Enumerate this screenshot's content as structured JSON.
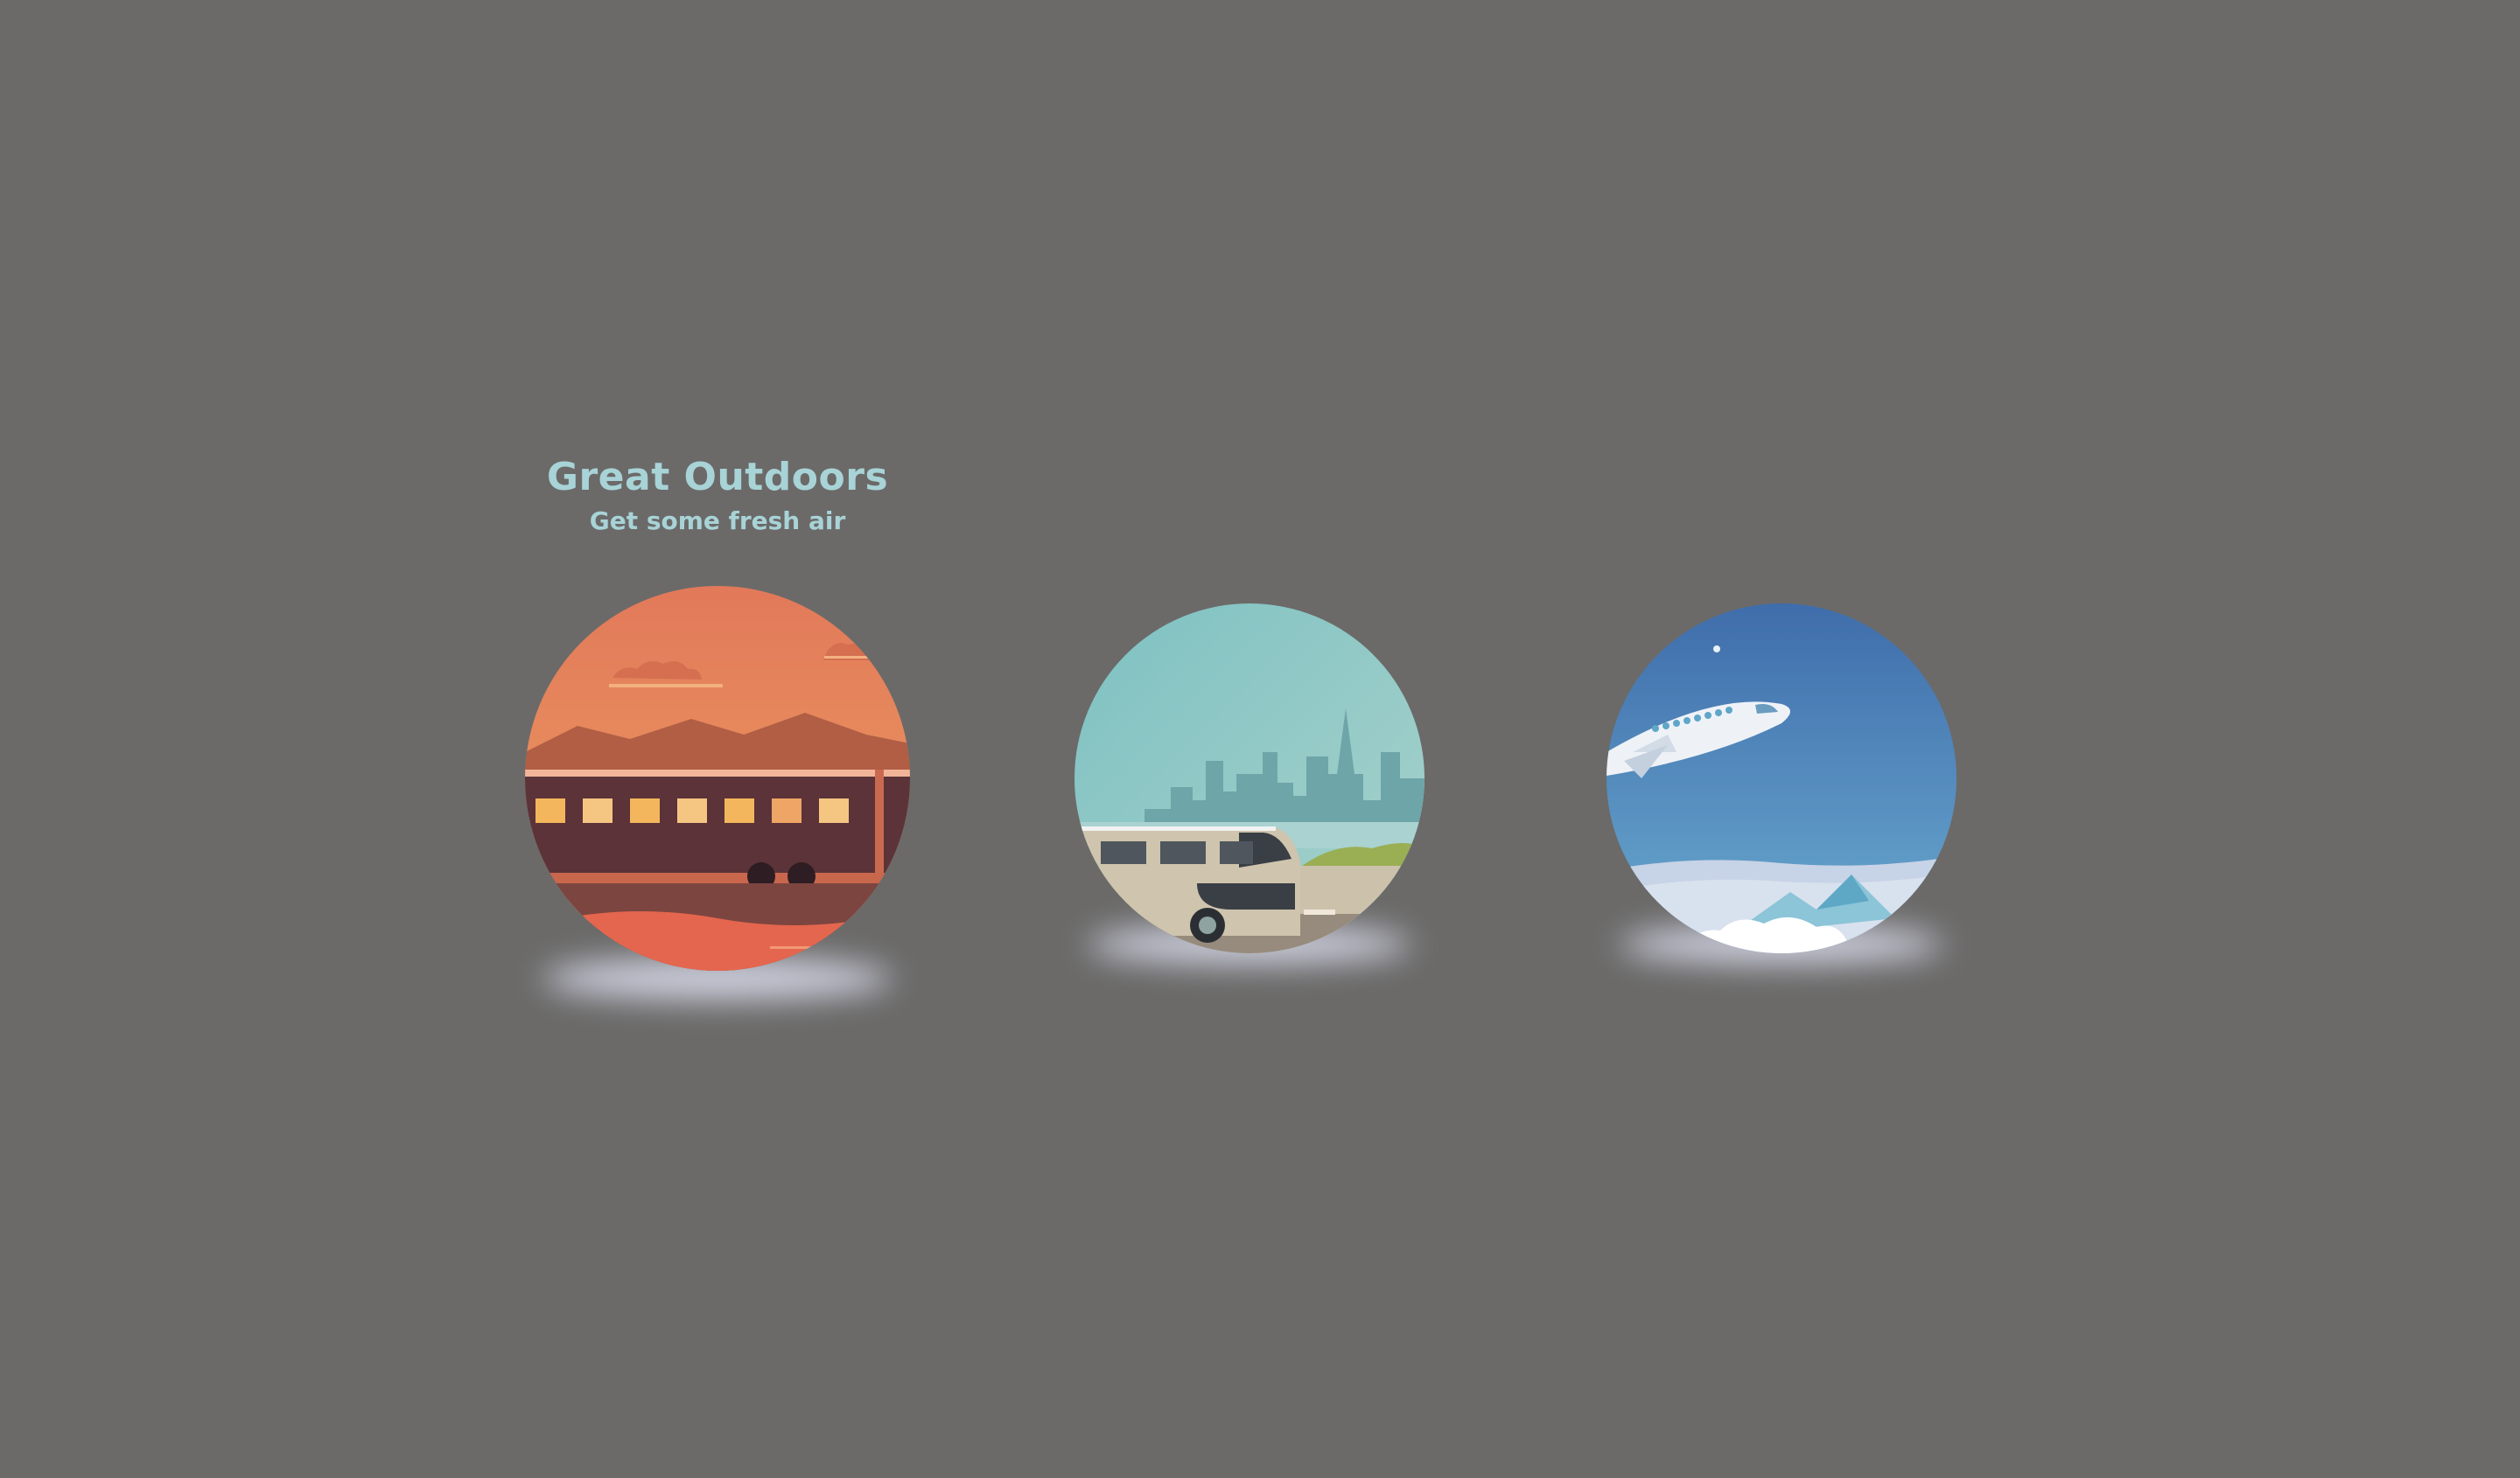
{
  "cards": [
    {
      "id": "train",
      "title": "Great Outdoors",
      "subtitle": "Get some fresh air",
      "active": true,
      "colors": {
        "sky_top": "#e2795a",
        "sky_bottom": "#ea9b5e",
        "hills": "#b15e45",
        "train": "#5b3338",
        "window": "#f3b65c",
        "ground": "#7d4540",
        "water": "#e4664e"
      }
    },
    {
      "id": "bus",
      "active": false,
      "colors": {
        "sky_top": "#7ec1c2",
        "sky_bottom": "#a4d0c9",
        "city": "#6ea5a8",
        "bus_body": "#cfc4ad",
        "bus_glass": "#3a3f45",
        "grass": "#9aae54",
        "road": "#978b7d"
      }
    },
    {
      "id": "plane",
      "active": false,
      "colors": {
        "sky_top": "#3f6dab",
        "sky_bottom": "#69a8cf",
        "plane": "#eef2f7",
        "mountain": "#8cc4d8",
        "cloud": "#ffffff"
      }
    }
  ]
}
